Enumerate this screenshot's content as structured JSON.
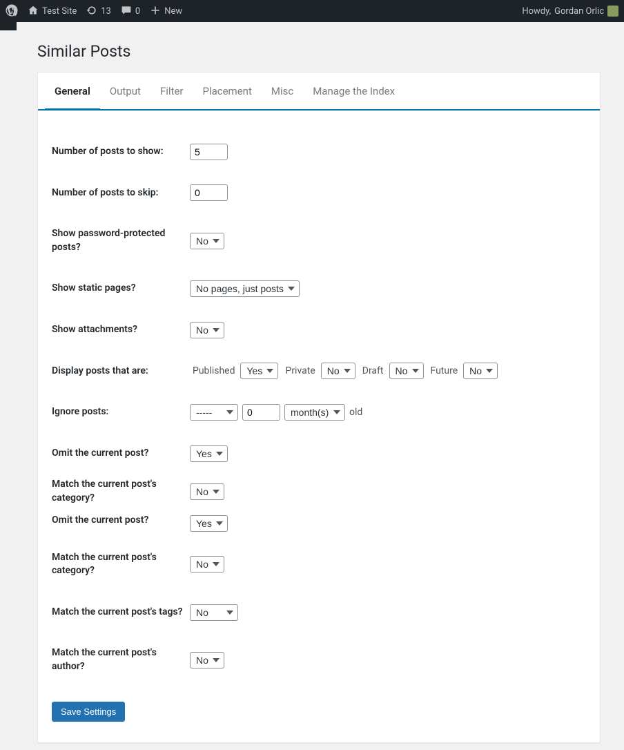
{
  "adminbar": {
    "site_name": "Test Site",
    "updates_count": "13",
    "comments_count": "0",
    "new_label": "New",
    "howdy_prefix": "Howdy,",
    "user_name": "Gordan Orlic"
  },
  "page": {
    "title": "Similar Posts"
  },
  "tabs": [
    {
      "label": "General",
      "active": true
    },
    {
      "label": "Output"
    },
    {
      "label": "Filter"
    },
    {
      "label": "Placement"
    },
    {
      "label": "Misc"
    },
    {
      "label": "Manage the Index"
    }
  ],
  "fields": {
    "num_show": {
      "label": "Number of posts to show:",
      "value": "5"
    },
    "num_skip": {
      "label": "Number of posts to skip:",
      "value": "0"
    },
    "show_protected": {
      "label": "Show password-protected posts?",
      "value": "No"
    },
    "show_pages": {
      "label": "Show static pages?",
      "value": "No pages, just posts"
    },
    "show_attachments": {
      "label": "Show attachments?",
      "value": "No"
    },
    "display_status": {
      "label": "Display posts that are:",
      "published_label": "Published",
      "published_value": "Yes",
      "private_label": "Private",
      "private_value": "No",
      "draft_label": "Draft",
      "draft_value": "No",
      "future_label": "Future",
      "future_value": "No"
    },
    "ignore": {
      "label": "Ignore posts:",
      "compare": "-----",
      "amount": "0",
      "unit": "month(s)",
      "suffix": "old"
    },
    "omit_current_1": {
      "label": "Omit the current post?",
      "value": "Yes"
    },
    "match_category_1": {
      "label": "Match the current post's category?",
      "value": "No"
    },
    "omit_current_2": {
      "label": "Omit the current post?",
      "value": "Yes"
    },
    "match_category_2": {
      "label": "Match the current post's category?",
      "value": "No"
    },
    "match_tags": {
      "label": "Match the current post's tags?",
      "value": "No"
    },
    "match_author": {
      "label": "Match the current post's author?",
      "value": "No"
    }
  },
  "buttons": {
    "save": "Save Settings"
  }
}
